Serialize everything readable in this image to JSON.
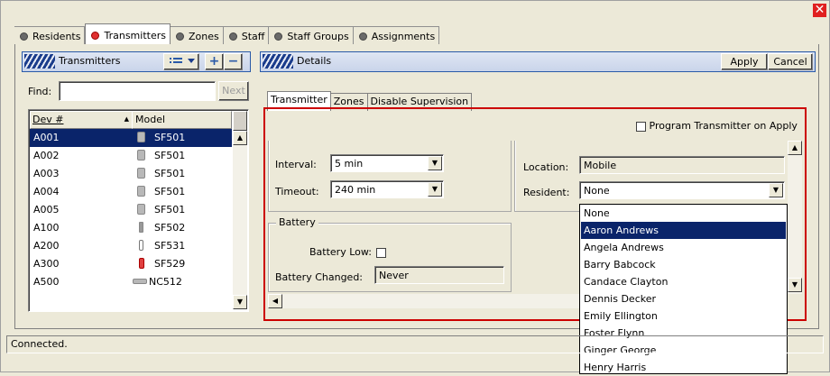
{
  "window": {
    "close_glyph": "✕"
  },
  "tabs": [
    {
      "label": "Residents",
      "active": false
    },
    {
      "label": "Transmitters",
      "active": true
    },
    {
      "label": "Zones",
      "active": false
    },
    {
      "label": "Staff",
      "active": false
    },
    {
      "label": "Staff Groups",
      "active": false
    },
    {
      "label": "Assignments",
      "active": false
    }
  ],
  "left_panel": {
    "title": "Transmitters",
    "view_icon": "list-view-icon",
    "add_label": "+",
    "remove_label": "−",
    "find_label": "Find:",
    "find_value": "",
    "next_label": "Next",
    "columns": [
      "Dev #",
      "Model"
    ],
    "rows": [
      {
        "dev": "A001",
        "model": "SF501",
        "icon": "pendant-icon",
        "selected": true
      },
      {
        "dev": "A002",
        "model": "SF501",
        "icon": "pendant-icon",
        "selected": false
      },
      {
        "dev": "A003",
        "model": "SF501",
        "icon": "pendant-icon",
        "selected": false
      },
      {
        "dev": "A004",
        "model": "SF501",
        "icon": "pendant-icon",
        "selected": false
      },
      {
        "dev": "A005",
        "model": "SF501",
        "icon": "pendant-icon",
        "selected": false
      },
      {
        "dev": "A100",
        "model": "SF502",
        "icon": "wristband-icon",
        "selected": false
      },
      {
        "dev": "A200",
        "model": "SF531",
        "icon": "pull-cord-icon",
        "selected": false
      },
      {
        "dev": "A300",
        "model": "SF529",
        "icon": "panic-button-icon",
        "selected": false
      },
      {
        "dev": "A500",
        "model": "NC512",
        "icon": "receiver-icon",
        "selected": false
      }
    ]
  },
  "details": {
    "title": "Details",
    "apply_label": "Apply",
    "cancel_label": "Cancel",
    "subtabs": [
      {
        "label": "Transmitter",
        "active": true
      },
      {
        "label": "Zones",
        "active": false
      },
      {
        "label": "Disable Supervision",
        "active": false
      }
    ],
    "program_on_apply_label": "Program Transmitter on Apply",
    "interval_label": "Interval:",
    "interval_value": "5 min",
    "timeout_label": "Timeout:",
    "timeout_value": "240 min",
    "battery_group": "Battery",
    "battery_low_label": "Battery Low:",
    "battery_changed_label": "Battery Changed:",
    "battery_changed_value": "Never",
    "location_label": "Location:",
    "location_value": "Mobile",
    "resident_label": "Resident:",
    "resident_value": "None",
    "resident_options": [
      "None",
      "Aaron Andrews",
      "Angela Andrews",
      "Barry Babcock",
      "Candace Clayton",
      "Dennis Decker",
      "Emily Ellington",
      "Foster Flynn",
      "Ginger George",
      "Henry Harris"
    ],
    "resident_highlighted": "Aaron Andrews"
  },
  "status": {
    "text": "Connected."
  },
  "colors": {
    "selection": "#0a246a",
    "frame_red": "#cc0000",
    "header_blue": "#2a5aa8"
  }
}
